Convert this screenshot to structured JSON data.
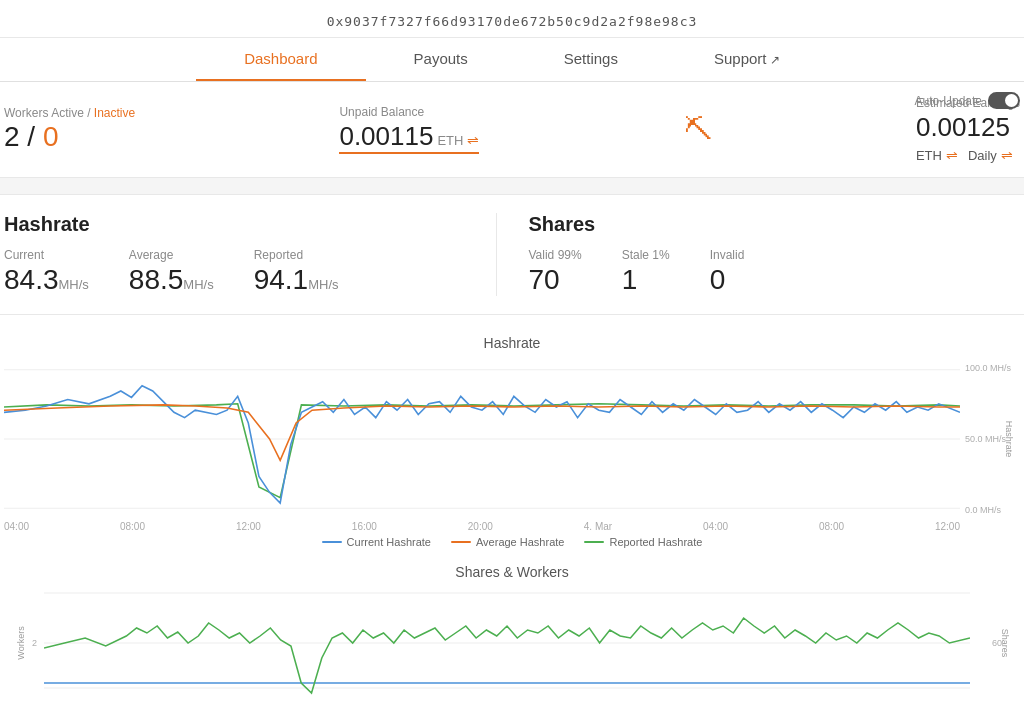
{
  "wallet": {
    "address": "0x9037f7327f66d93170de672b50c9d2a2f98e98c3"
  },
  "nav": {
    "items": [
      {
        "label": "Dashboard",
        "active": true,
        "external": false
      },
      {
        "label": "Payouts",
        "active": false,
        "external": false
      },
      {
        "label": "Settings",
        "active": false,
        "external": false
      },
      {
        "label": "Support",
        "active": false,
        "external": true
      }
    ]
  },
  "auto_update": {
    "label": "Auto-Update",
    "enabled": true
  },
  "workers": {
    "label": "Workers Active / Inactive",
    "active": "2",
    "separator": " / ",
    "inactive": "0"
  },
  "unpaid": {
    "label": "Unpaid Balance",
    "value": "0.00115",
    "unit": "ETH"
  },
  "estimated": {
    "label": "Estimated Earnings",
    "value": "0.00125",
    "currency": "ETH",
    "period": "Daily"
  },
  "hashrate": {
    "section_title": "Hashrate",
    "current_label": "Current",
    "current_value": "84.3",
    "current_unit": "MH/s",
    "average_label": "Average",
    "average_value": "88.5",
    "average_unit": "MH/s",
    "reported_label": "Reported",
    "reported_value": "94.1",
    "reported_unit": "MH/s"
  },
  "shares": {
    "section_title": "Shares",
    "valid_label": "Valid 99%",
    "valid_value": "70",
    "stale_label": "Stale 1%",
    "stale_value": "1",
    "invalid_label": "Invalid",
    "invalid_value": "0"
  },
  "chart_hashrate": {
    "title": "Hashrate",
    "y_label": "Hashrate",
    "y_max": "100.0 MH/s",
    "y_mid": "50.0 MH/s",
    "y_min": "0.0 MH/s",
    "x_labels": [
      "04:00",
      "08:00",
      "12:00",
      "16:00",
      "20:00",
      "4. Mar",
      "04:00",
      "08:00",
      "12:00"
    ],
    "legend": [
      {
        "label": "Current Hashrate",
        "color": "#4a90d9"
      },
      {
        "label": "Average Hashrate",
        "color": "#e87020"
      },
      {
        "label": "Reported Hashrate",
        "color": "#4caf50"
      }
    ]
  },
  "chart_shares": {
    "title": "Shares & Workers",
    "y_left_label": "Workers",
    "y_left_value": "2",
    "y_right_label": "Shares",
    "y_right_value": "60"
  }
}
